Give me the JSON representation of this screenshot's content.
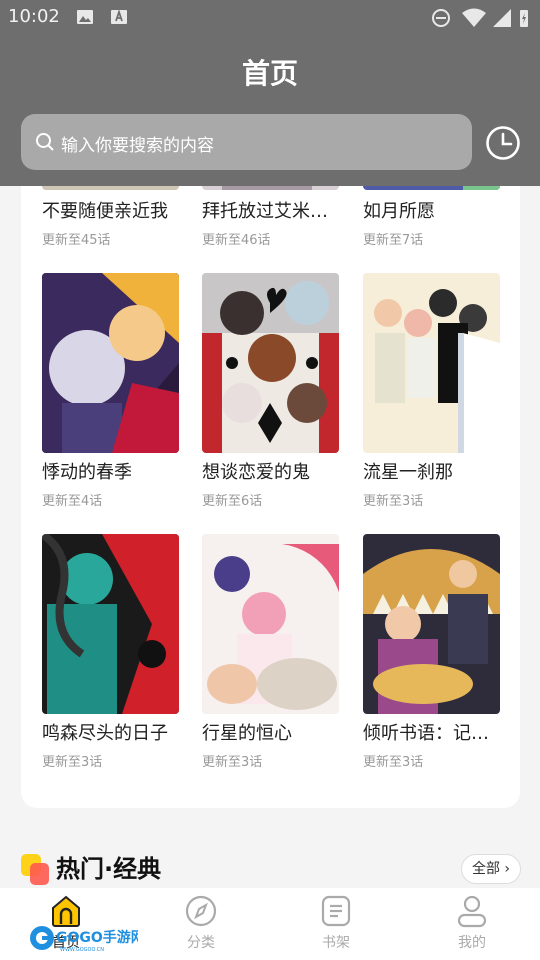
{
  "status_bar": {
    "time": "10:02"
  },
  "header": {
    "title": "首页",
    "search_placeholder": "输入你要搜索的内容"
  },
  "grid": {
    "partial_row": [
      {
        "title": "不要随便亲近我",
        "update": "更新至45话"
      },
      {
        "title": "拜托放过艾米…",
        "update": "更新至46话"
      },
      {
        "title": "如月所愿",
        "update": "更新至7话"
      }
    ],
    "rows": [
      [
        {
          "title": "悸动的春季",
          "update": "更新至4话"
        },
        {
          "title": "想谈恋爱的鬼",
          "update": "更新至6话"
        },
        {
          "title": "流星一刹那",
          "update": "更新至3话"
        }
      ],
      [
        {
          "title": "鸣森尽头的日子",
          "update": "更新至3话"
        },
        {
          "title": "行星的恒心",
          "update": "更新至3话"
        },
        {
          "title": "倾听书语：记…",
          "update": "更新至3话"
        }
      ]
    ]
  },
  "section": {
    "title": "热门·经典",
    "all_label": "全部",
    "all_chevron": "›"
  },
  "nav": {
    "items": [
      {
        "label": "首页",
        "icon": "home-icon",
        "active": true
      },
      {
        "label": "分类",
        "icon": "compass-icon"
      },
      {
        "label": "书架",
        "icon": "bookshelf-icon"
      },
      {
        "label": "我的",
        "icon": "user-icon"
      }
    ]
  },
  "watermark": {
    "text": "GOGO手游网",
    "sub": "WWW.GOGOO.CN"
  },
  "colors": {
    "accent": "#ffc400",
    "header_overlay": "#6e6e6e",
    "section_icon_a": "#ffd21a",
    "section_icon_b": "#ff5a4f"
  }
}
